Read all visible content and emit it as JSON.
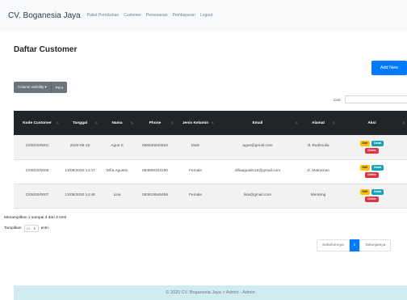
{
  "navbar": {
    "brand": "CV. Boganesia Jaya",
    "links": [
      "Paket Pernikahan",
      "Customer",
      "Pemesanan",
      "Pembayaran",
      "Logout"
    ]
  },
  "page_title": "Daftar Customer",
  "add_button": "Add New",
  "buttons": {
    "column_visibility": "Column visibility ▾",
    "print": "Print"
  },
  "search": {
    "label": "Cari:",
    "value": ""
  },
  "table": {
    "headers": [
      "Kode Customer",
      "Tanggal",
      "Nama",
      "Phone",
      "Jenis Kelamin",
      "Email",
      "Alamat",
      "Aksi"
    ],
    "sort_icon": "⇅",
    "rows": [
      {
        "kode": "C/08/20/0001",
        "tanggal": "2020-08-10",
        "nama": "Agus S",
        "phone": "086530840822",
        "jk": "Male",
        "email": "agus@gmail.com",
        "alamat": "Jl. Budimulia"
      },
      {
        "kode": "C/08/20/0005",
        "tanggal": "13/08/2020 14:47",
        "nama": "Difia Agustin",
        "phone": "083806333190",
        "jk": "Female",
        "email": "difiaagustin18@gmail.com",
        "alamat": "Jl. Matraman"
      },
      {
        "kode": "C/08/20/0007",
        "tanggal": "13/08/2020 14:48",
        "nama": "Lisa",
        "phone": "083819546456",
        "jk": "Female",
        "email": "lisa@gmail.com",
        "alamat": "Menteng"
      }
    ],
    "actions": {
      "edit": "Edit",
      "detail": "Detail",
      "delete": "Delete"
    }
  },
  "info": "Menampilkan 1 sampai 3 dari 3 entri",
  "length": {
    "prefix": "Tampilkan",
    "value": "10",
    "caret": "⬍",
    "suffix": "entri"
  },
  "pagination": {
    "prev": "Sebelumnya",
    "current": "1",
    "next": "Selanjutnya"
  },
  "footer": "© 2020 CV. Boganesia Jaya > Admin - Admin",
  "colors": {
    "primary": "#007bff",
    "dark": "#212529",
    "secondary": "#6c757d",
    "warning": "#ffc107",
    "info": "#17a2b8",
    "danger": "#dc3545",
    "footer_bg": "#d1ecf1"
  }
}
